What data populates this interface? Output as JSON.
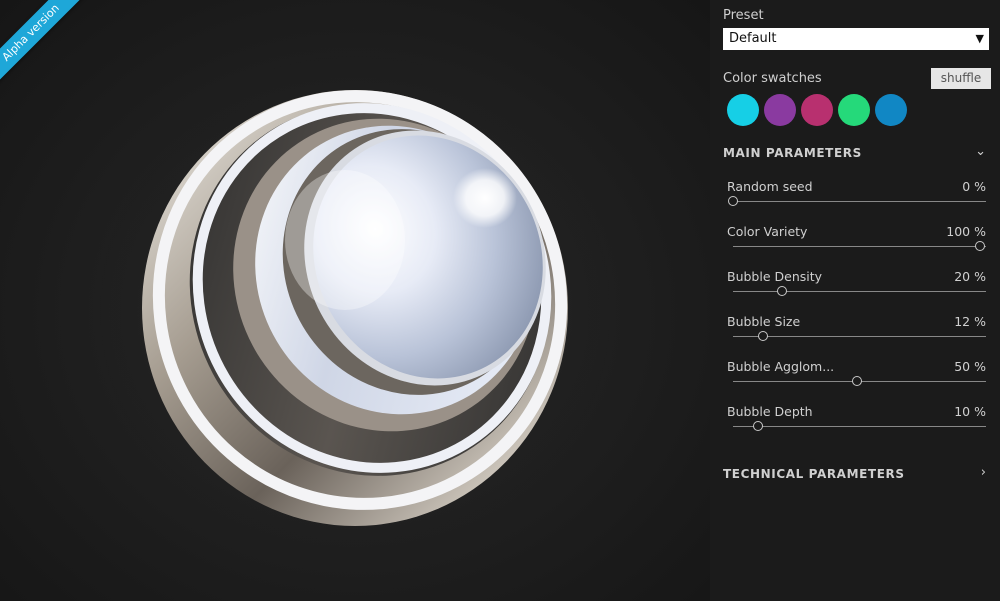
{
  "ribbon": {
    "text": "Alpha version",
    "color": "#1ea7d8"
  },
  "preset": {
    "label": "Preset",
    "value": "Default"
  },
  "swatches": {
    "label": "Color swatches",
    "shuffle_label": "shuffle",
    "colors": [
      "#16cfe6",
      "#8a3aa0",
      "#b8306f",
      "#25d97a",
      "#1187c4"
    ]
  },
  "main_parameters": {
    "title": "MAIN PARAMETERS",
    "params": [
      {
        "name": "Random seed",
        "value": "0 %",
        "level": 0.0
      },
      {
        "name": "Color Variety",
        "value": "100 %",
        "level": 1.0
      },
      {
        "name": "Bubble Density",
        "value": "20 %",
        "level": 0.2
      },
      {
        "name": "Bubble Size",
        "value": "12 %",
        "level": 0.12
      },
      {
        "name": "Bubble Agglom...",
        "value": "50 %",
        "level": 0.5
      },
      {
        "name": "Bubble Depth",
        "value": "10 %",
        "level": 0.1
      }
    ]
  },
  "technical_parameters": {
    "title": "TECHNICAL PARAMETERS"
  }
}
